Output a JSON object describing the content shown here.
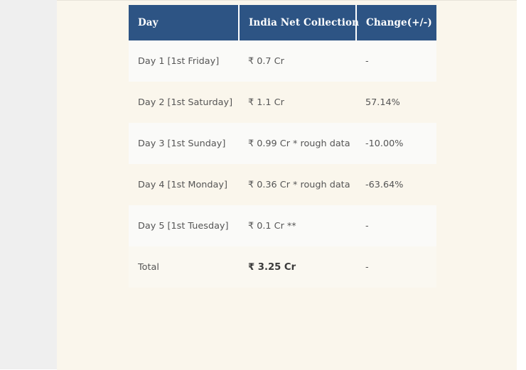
{
  "theme": {
    "header_bg": "#2d5484",
    "header_text": "#ffffff",
    "page_bg": "#faf6ec",
    "rail_bg": "#efefef",
    "row_odd_bg": "#fafaf8",
    "row_even_bg": "#faf6ec",
    "body_text": "#555555"
  },
  "table": {
    "columns": [
      {
        "key": "day",
        "label": "Day"
      },
      {
        "key": "collection",
        "label": "India Net Collection"
      },
      {
        "key": "change",
        "label": "Change(+/-)"
      }
    ],
    "rows": [
      {
        "day": "Day 1 [1st Friday]",
        "collection": "₹ 0.7 Cr",
        "change": "-"
      },
      {
        "day": "Day 2 [1st Saturday]",
        "collection": "₹ 1.1 Cr",
        "change": "57.14%"
      },
      {
        "day": "Day 3 [1st Sunday]",
        "collection": "₹ 0.99 Cr * rough data",
        "change": "-10.00%"
      },
      {
        "day": "Day 4 [1st Monday]",
        "collection": "₹ 0.36 Cr * rough data",
        "change": "-63.64%"
      },
      {
        "day": "Day 5 [1st Tuesday]",
        "collection": "₹ 0.1 Cr **",
        "change": "-"
      }
    ],
    "total_row": {
      "day": "Total",
      "collection": "₹ 3.25 Cr",
      "change": "-"
    }
  }
}
